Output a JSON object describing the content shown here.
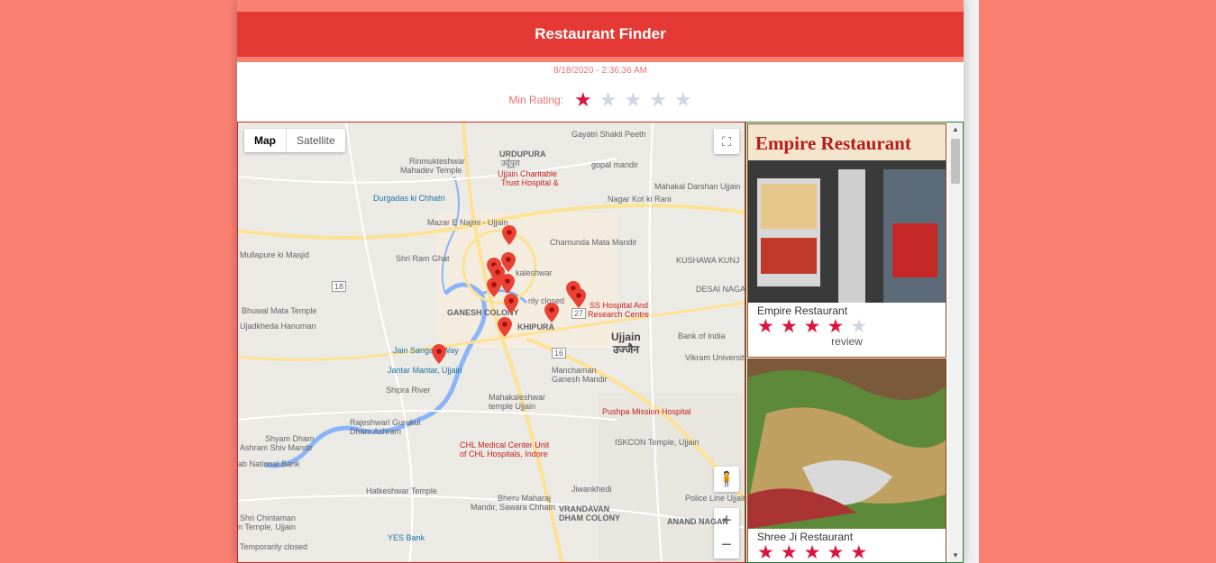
{
  "header": {
    "title": "Restaurant Finder"
  },
  "timestamp": "8/18/2020 - 2:36:36 AM",
  "rating": {
    "label": "Min Rating:",
    "value": 1,
    "max": 5
  },
  "map": {
    "type_map": "Map",
    "type_satellite": "Satellite",
    "city": "Ujjain",
    "city_hi": "उज्जैन",
    "labels": {
      "udupura": "URDUPURA",
      "udupura_hi": "उर्दूपुरा",
      "gayatri": "Gayatri Shakti Peeth",
      "rinmukteshwar": "Rinmukteshwar",
      "mahadev_temple": "Mahadev Temple",
      "charitable": "Ujjain Charitable",
      "trust_hospital": "Trust Hospital &",
      "gopal_mandir": "gopal mandir",
      "mahakal_darshan": "Mahakal Darshan Ujjain",
      "durgadas": "Durgadas ki Chhatri",
      "nagar_kot": "Nagar Kot ki Rani",
      "mazar": "Mazar E Najmi - Ujjain",
      "chamunda": "Chamunda Mata Mandir",
      "mullapure": "Mullapure ki Masjid",
      "shri_ram_ghat": "Shri Ram Ghat",
      "kushawa": "KUSHAWA KUNJ",
      "mahakaleshwar_top": "kaleshwar",
      "desai": "DESAI NAGAR",
      "bhuwal": "Bhuwal Mata Temple",
      "ganesh_colony": "GANESH COLONY",
      "ss_hospital": "SS Hospital And",
      "research_centre": "Research Centre",
      "ujadkheda": "Ujadkheda Hanuman",
      "khipura": "KHIPURA",
      "bank_india": "Bank of India",
      "jain_sangam": "Jain Sangam Way",
      "jantar": "Jantar Mantar, Ujjain",
      "vikram": "Vikram University",
      "shipra": "Shipra River",
      "manchaman": "Manchaman",
      "ganesh_mandir": "Ganesh Mandir",
      "mahakal_temple": "Mahakaleshwar",
      "temple_ujjain": "temple Ujjain",
      "pushpa": "Pushpa Mission Hospital",
      "rajeshwari": "Rajeshwari Gurukul",
      "dham_ashram": "Dham Ashram",
      "shyam": "Shyam Dham",
      "ashram_shiv": "Ashram Shiv Mandir",
      "chl": "CHL Medical Center Unit",
      "chl2": "of CHL Hospitals, Indore",
      "iskcon": "ISKCON Temple, Ujjain",
      "national_bank": "ab National Bank",
      "hatkeshwar": "Hatkeshwar Temple",
      "bheru": "Bheru Maharaj",
      "mandir_sawara": "Mandir, Sawara Chhatri",
      "jiwankhedi": "Jiwankhedi",
      "vrandavan": "VRANDAVAN",
      "dham_colony": "DHAM COLONY",
      "police": "Police Line Ujjain",
      "anand": "ANAND NAGAR",
      "shri_chintaman": "Shri Chintaman",
      "n_temple": "n Temple, Ujjain",
      "temp_closed": "Temporarily closed",
      "yes_bank": "YES Bank",
      "rly_closed": "rily closed",
      "road_18": "18",
      "road_27": "27",
      "road_16": "16"
    }
  },
  "restaurants": [
    {
      "name": "Empire Restaurant",
      "rating": 4,
      "review": "review",
      "sign": "Empire Restaurant"
    },
    {
      "name": "Shree Ji Restaurant",
      "rating": 4.5
    }
  ],
  "colors": {
    "background": "#fa8072",
    "header": "#e53935",
    "star_on": "#dc143c",
    "star_off": "#cfd6e4"
  }
}
